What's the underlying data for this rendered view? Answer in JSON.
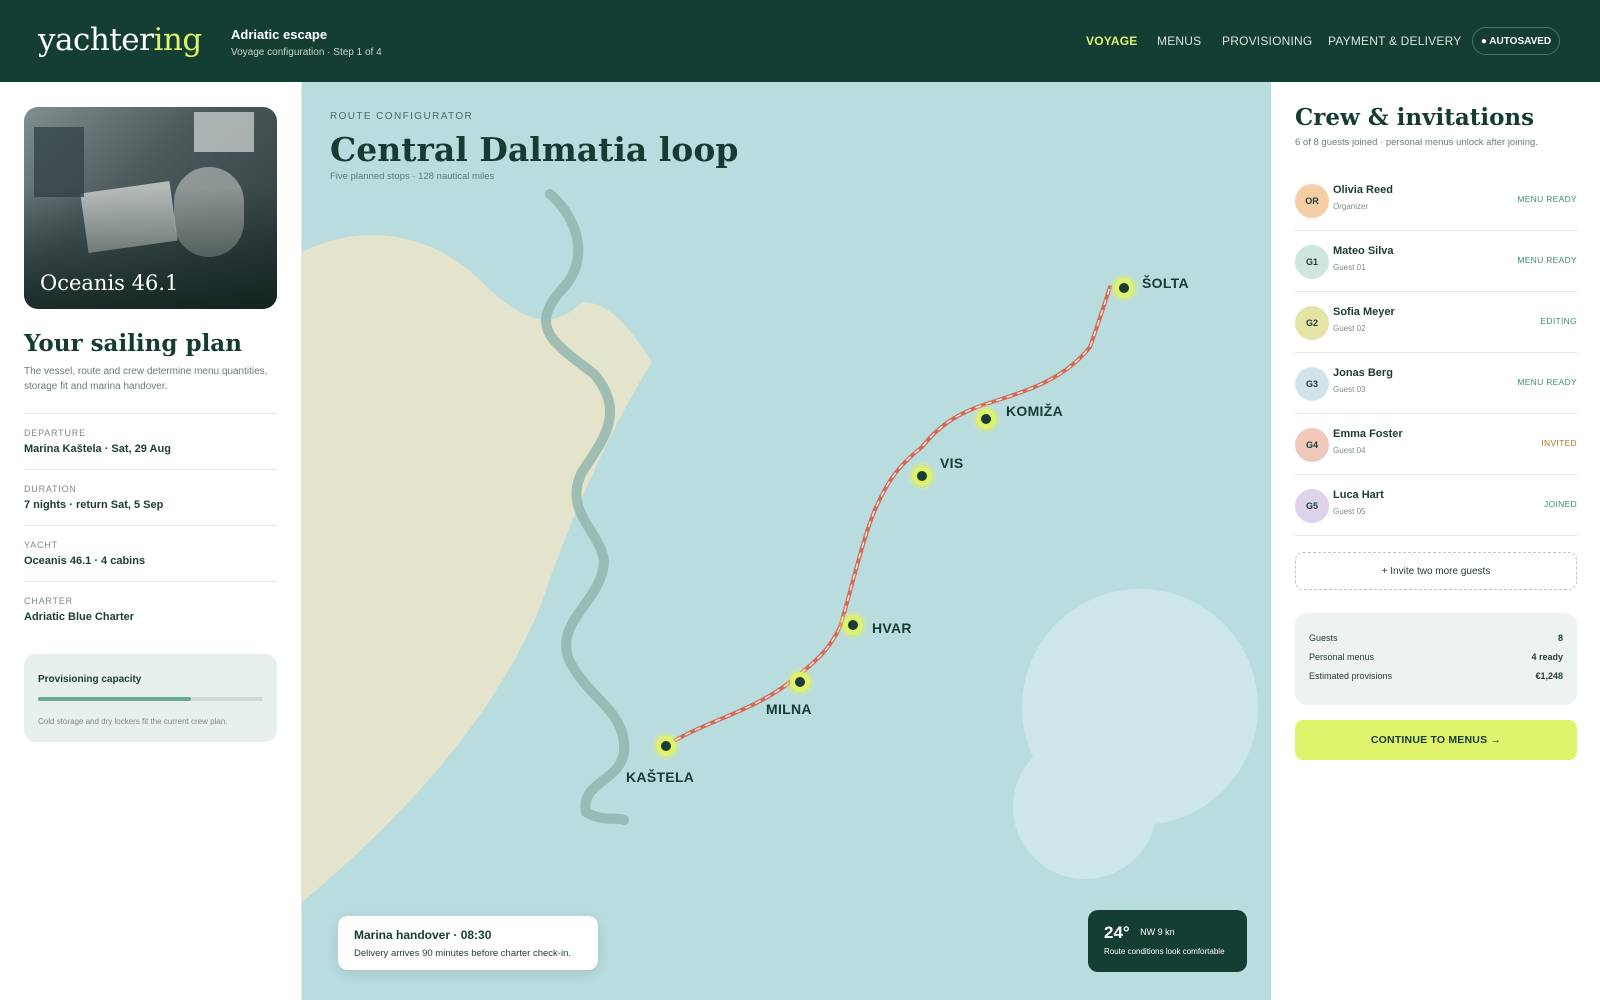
{
  "header": {
    "logo_main": "yachter",
    "logo_accent": "ing",
    "trip_title": "Adriatic escape",
    "trip_subtitle": "Voyage configuration · Step 1 of 4",
    "nav": [
      {
        "label": "VOYAGE",
        "active": true
      },
      {
        "label": "MENUS",
        "active": false
      },
      {
        "label": "PROVISIONING",
        "active": false
      },
      {
        "label": "PAYMENT & DELIVERY",
        "active": false
      }
    ],
    "autosaved": "● AUTOSAVED",
    "accent_color": "#dff26b",
    "bar_color": "#143d34"
  },
  "sidebar": {
    "yacht_image_label": "Oceanis 46.1",
    "title": "Your sailing plan",
    "description": "The vessel, route and crew determine menu quantities, storage fit and marina handover.",
    "specs": [
      {
        "label": "DEPARTURE",
        "value": "Marina Kaštela · Sat, 29 Aug"
      },
      {
        "label": "DURATION",
        "value": "7 nights · return Sat, 5 Sep"
      },
      {
        "label": "YACHT",
        "value": "Oceanis 46.1 · 4 cabins"
      },
      {
        "label": "CHARTER",
        "value": "Adriatic Blue Charter"
      }
    ],
    "capacity": {
      "title": "Provisioning capacity",
      "fill_fraction": 0.68,
      "note": "Cold storage and dry lockers fit the current crew plan."
    }
  },
  "map": {
    "eyebrow": "ROUTE CONFIGURATOR",
    "title": "Central Dalmatia loop",
    "subtitle": "Five planned stops · 128 nautical miles",
    "stops": [
      "KAŠTELA",
      "MILNA",
      "HVAR",
      "VIS",
      "KOMIŽA",
      "ŠOLTA"
    ],
    "handover": {
      "title": "Marina handover · 08:30",
      "subtitle": "Delivery arrives 90 minutes before charter check-in."
    },
    "weather": {
      "temp": "24°",
      "wind": "NW 9 kn",
      "note": "Route conditions look comfortable"
    }
  },
  "crew": {
    "title": "Crew & invitations",
    "subtitle": "6 of 8 guests joined · personal menus unlock after joining.",
    "members": [
      {
        "initials": "OR",
        "name": "Olivia Reed",
        "role": "Organizer",
        "status": "MENU READY",
        "color": "#f6cfa6"
      },
      {
        "initials": "G1",
        "name": "Mateo Silva",
        "role": "Guest 01",
        "status": "MENU READY",
        "color": "#cfe6dc"
      },
      {
        "initials": "G2",
        "name": "Sofia Meyer",
        "role": "Guest 02",
        "status": "EDITING",
        "color": "#e6e3a6"
      },
      {
        "initials": "G3",
        "name": "Jonas Berg",
        "role": "Guest 03",
        "status": "MENU READY",
        "color": "#d4e3ea"
      },
      {
        "initials": "G4",
        "name": "Emma Foster",
        "role": "Guest 04",
        "status": "INVITED",
        "color": "#f0c8bc"
      },
      {
        "initials": "G5",
        "name": "Luca Hart",
        "role": "Guest 05",
        "status": "JOINED",
        "color": "#ddd3ea"
      }
    ],
    "invite_label": "+ Invite two more guests",
    "summary": [
      {
        "label": "Guests",
        "value": "8"
      },
      {
        "label": "Personal menus",
        "value": "4 ready"
      },
      {
        "label": "Estimated provisions",
        "value": "€1,248"
      }
    ],
    "cta": "CONTINUE TO MENUS →"
  }
}
